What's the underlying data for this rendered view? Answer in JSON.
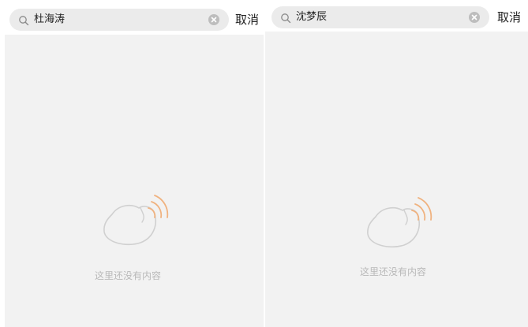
{
  "screens": [
    {
      "search": {
        "query": "杜海涛"
      },
      "cancel_label": "取消",
      "empty_message": "这里还没有内容"
    },
    {
      "search": {
        "query": "沈梦辰"
      },
      "cancel_label": "取消",
      "empty_message": "这里还没有内容"
    }
  ],
  "colors": {
    "search_bg": "#ebebeb",
    "content_bg": "#f2f2f2",
    "empty_text": "#b9b9b9",
    "illustration_outline": "#d0d0d0",
    "illustration_waves": "#f0b27f"
  },
  "icons": {
    "search": "search-icon",
    "clear": "clear-icon",
    "empty_state": "empty-state-illustration"
  }
}
